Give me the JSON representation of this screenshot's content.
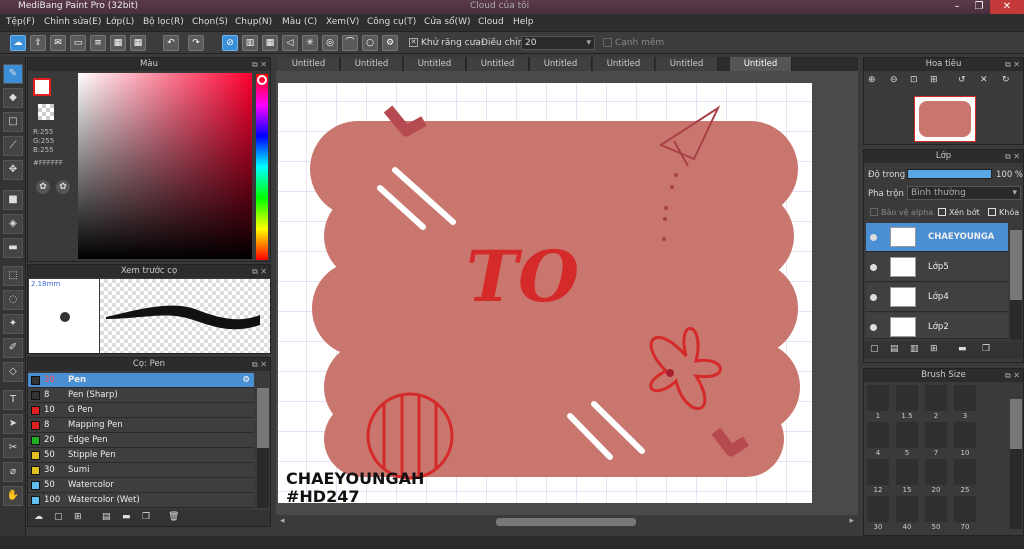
{
  "window": {
    "title": "MediBang Paint Pro (32bit)",
    "center_title": "Cloud của tôi"
  },
  "menu": [
    "Tệp(F)",
    "Chỉnh sửa(E)",
    "Lớp(L)",
    "Bộ lọc(R)",
    "Chọn(S)",
    "Chụp(N)",
    "Màu (C)",
    "Xem(V)",
    "Công cụ(T)",
    "Cửa sổ(W)",
    "Cloud",
    "Help"
  ],
  "toolbar": {
    "antialias_label": "Khử răng cưa",
    "adjust_label": "Điều chỉnh",
    "adjust_value": "20",
    "snap_label": "Cạnh mềm"
  },
  "color_panel": {
    "title": "Màu",
    "r": "R:255",
    "g": "G:255",
    "b": "B:255",
    "hex": "#FFFFFF"
  },
  "preview_panel": {
    "title": "Xem trước cọ",
    "size": "2.18mm"
  },
  "brush_panel": {
    "title": "Cọ: Pen",
    "brushes": [
      {
        "size": "30",
        "name": "Pen",
        "color": "#333333"
      },
      {
        "size": "8",
        "name": "Pen (Sharp)",
        "color": "#333333"
      },
      {
        "size": "10",
        "name": "G Pen",
        "color": "#e02020"
      },
      {
        "size": "8",
        "name": "Mapping Pen",
        "color": "#e02020"
      },
      {
        "size": "20",
        "name": "Edge Pen",
        "color": "#20b020"
      },
      {
        "size": "50",
        "name": "Stipple Pen",
        "color": "#e0c020"
      },
      {
        "size": "30",
        "name": "Sumi",
        "color": "#e0c020"
      },
      {
        "size": "50",
        "name": "Watercolor",
        "color": "#60c0f0"
      },
      {
        "size": "100",
        "name": "Watercolor (Wet)",
        "color": "#60c0f0"
      }
    ]
  },
  "tabs": [
    "Untitled",
    "Untitled",
    "Untitled",
    "Untitled",
    "Untitled",
    "Untitled",
    "Untitled",
    "Untitled"
  ],
  "artwork": {
    "letters": "TO",
    "caption1": "CHAEYOUNGAH",
    "caption2": "#HD247"
  },
  "navigator": {
    "title": "Hoa tiêu"
  },
  "layer_panel": {
    "title": "Lớp",
    "opacity_label": "Độ trong",
    "opacity_value": "100 %",
    "blend_label": "Pha trộn",
    "blend_value": "Bình thường",
    "protect_alpha": "Bảo vệ alpha",
    "clip": "Xén bớt",
    "lock": "Khóa",
    "layers": [
      {
        "name": "CHAEYOUNGA"
      },
      {
        "name": "Lớp5"
      },
      {
        "name": "Lớp4"
      },
      {
        "name": "Lớp2"
      }
    ]
  },
  "brush_size": {
    "title": "Brush Size",
    "sizes": [
      "1",
      "1.5",
      "2",
      "3",
      "4",
      "5",
      "7",
      "10",
      "12",
      "15",
      "20",
      "25",
      "30",
      "40",
      "50",
      "70"
    ]
  },
  "colors": {
    "accent": "#3b8fd6",
    "shape": "#c9766e",
    "red": "#d42a2a"
  }
}
